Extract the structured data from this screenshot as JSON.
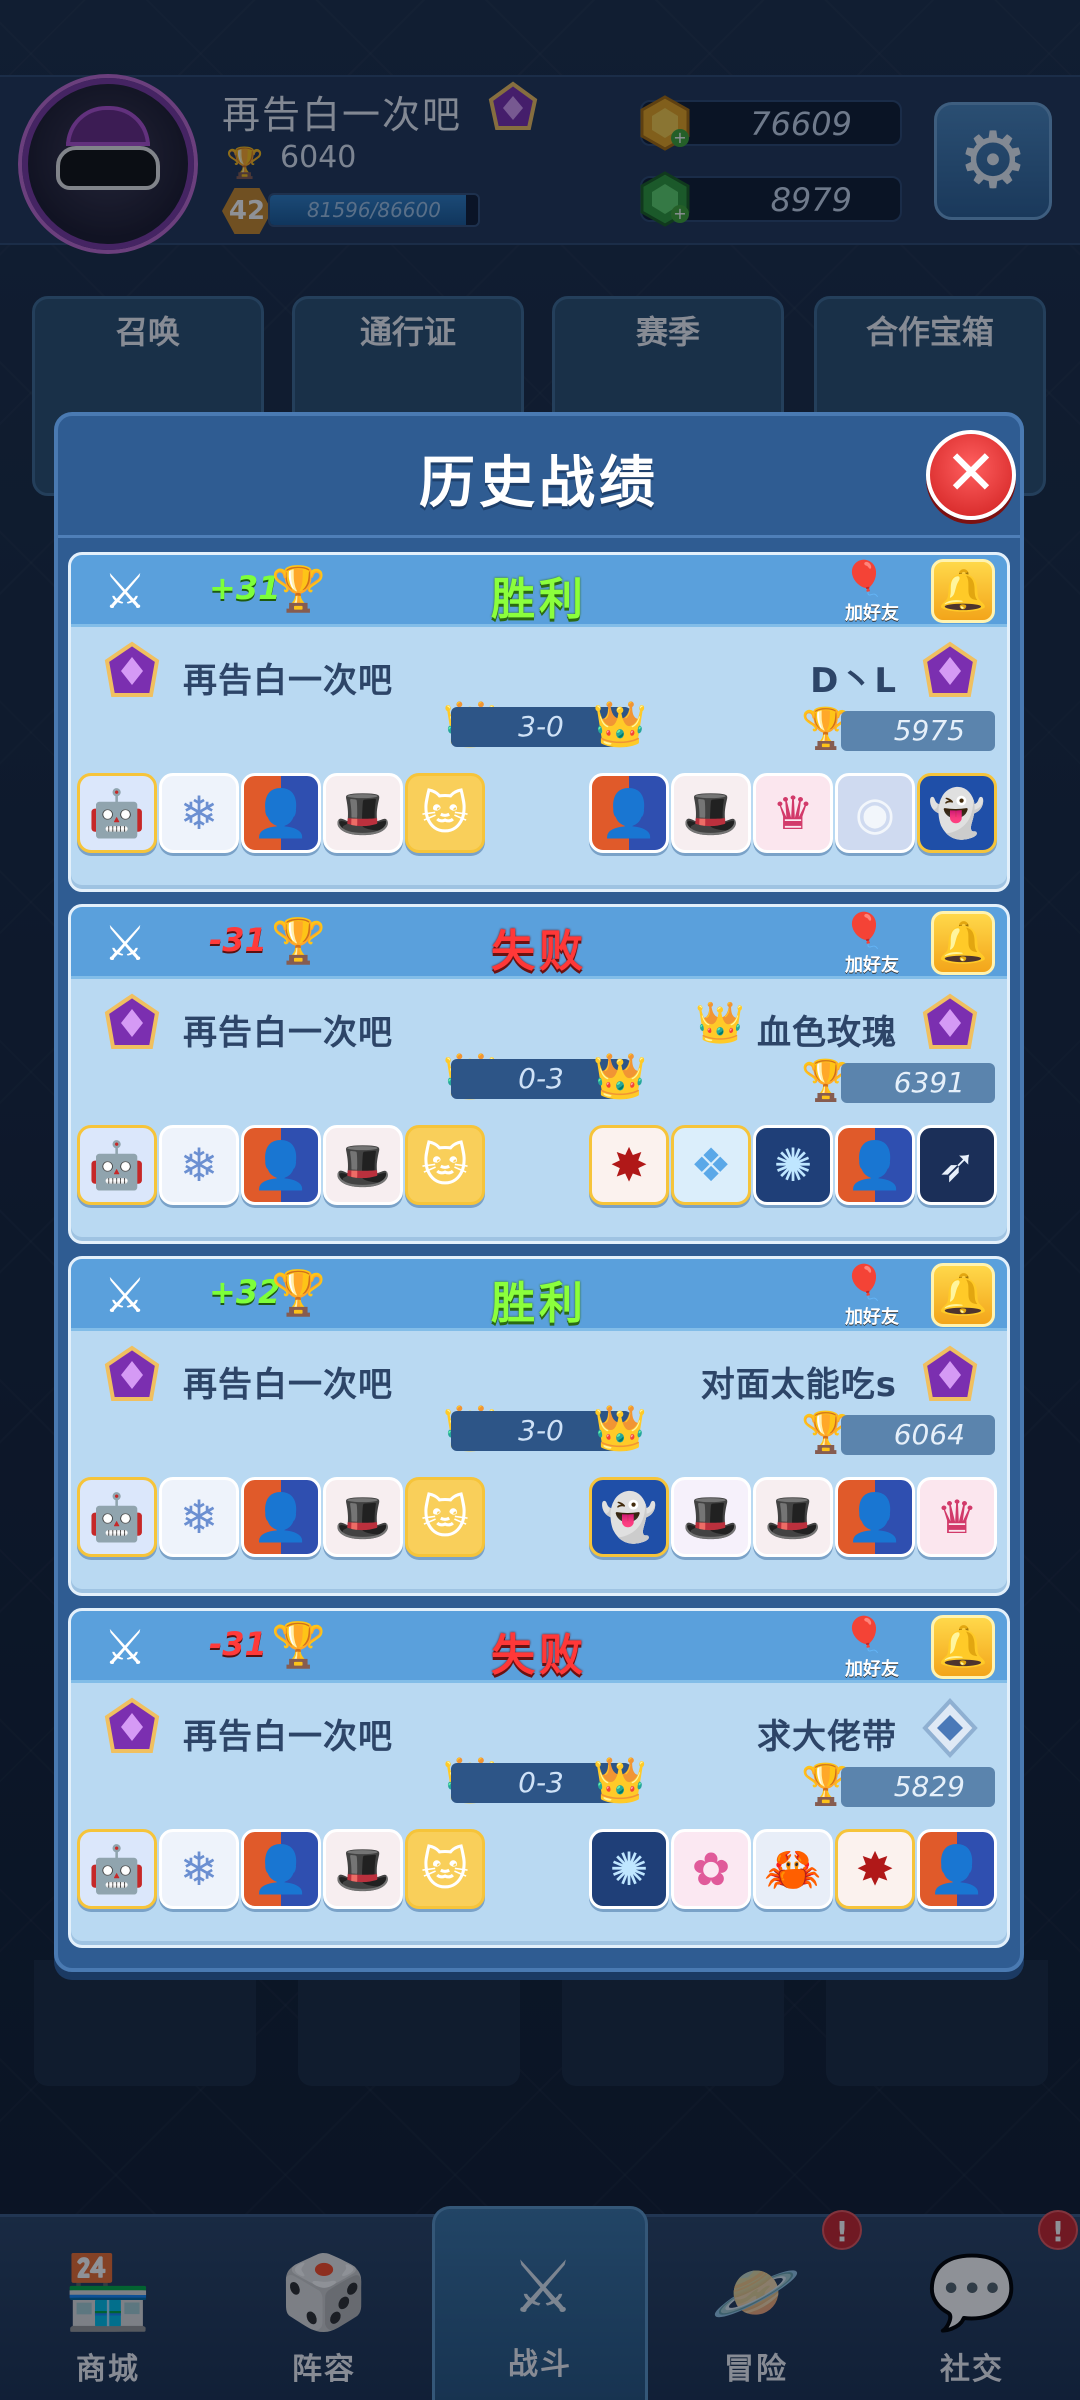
{
  "player": {
    "name": "再告白一次吧",
    "trophies": "6040",
    "level": "42",
    "xp_text": "81596/86600",
    "xp_fraction": 0.942,
    "coins": "76609",
    "gems": "8979"
  },
  "tiles": [
    "召唤",
    "通行证",
    "赛季",
    "合作宝箱"
  ],
  "modal": {
    "title": "历史战绩",
    "close_icon": "close-icon"
  },
  "battles": [
    {
      "delta": "+31",
      "result": "胜利",
      "outcome": "win",
      "add_friend": "加好友",
      "player": "再告白一次吧",
      "score": "3-0",
      "opponent": "D丶L",
      "opponent_trophies": "5975",
      "opponent_crown": false,
      "player_dice": [
        "robot-die-icon",
        "snowflake-die-icon",
        "split-die-icon",
        "hat-die-icon",
        "cat-die-icon"
      ],
      "opponent_dice": [
        "split-die-icon",
        "hat-die-icon",
        "throne-die-icon",
        "moon-die-icon",
        "ghost-die-icon"
      ]
    },
    {
      "delta": "-31",
      "result": "失败",
      "outcome": "lose",
      "add_friend": "加好友",
      "player": "再告白一次吧",
      "score": "0-3",
      "opponent": "血色玫瑰",
      "opponent_trophies": "6391",
      "opponent_crown": true,
      "player_dice": [
        "robot-die-icon",
        "snowflake-die-icon",
        "split-die-icon",
        "hat-die-icon",
        "cat-die-icon"
      ],
      "opponent_dice": [
        "blood-die-icon",
        "wing-die-icon",
        "energy-die-icon",
        "split-die-icon",
        "archer-die-icon"
      ]
    },
    {
      "delta": "+32",
      "result": "胜利",
      "outcome": "win",
      "add_friend": "加好友",
      "player": "再告白一次吧",
      "score": "3-0",
      "opponent": "对面太能吃s",
      "opponent_trophies": "6064",
      "opponent_crown": false,
      "player_dice": [
        "robot-die-icon",
        "snowflake-die-icon",
        "split-die-icon",
        "hat-die-icon",
        "cat-die-icon"
      ],
      "opponent_dice": [
        "ghost-die-icon",
        "magic-hat-die-icon",
        "hat-die-icon",
        "split-die-icon",
        "throne-die-icon"
      ]
    },
    {
      "delta": "-31",
      "result": "失败",
      "outcome": "lose",
      "add_friend": "加好友",
      "player": "再告白一次吧",
      "score": "0-3",
      "opponent": "求大佬带",
      "opponent_trophies": "5829",
      "opponent_crown": false,
      "player_dice": [
        "robot-die-icon",
        "snowflake-die-icon",
        "split-die-icon",
        "hat-die-icon",
        "cat-die-icon"
      ],
      "opponent_dice": [
        "energy-die-icon",
        "blossom-die-icon",
        "crab-die-icon",
        "blood-die-icon",
        "split-die-icon"
      ]
    }
  ],
  "nav": [
    {
      "label": "商城",
      "icon": "shop-icon"
    },
    {
      "label": "阵容",
      "icon": "dice-icon"
    },
    {
      "label": "战斗",
      "icon": "crossed-swords-icon"
    },
    {
      "label": "冒险",
      "icon": "planet-icon"
    },
    {
      "label": "社交",
      "icon": "chat-icon"
    }
  ],
  "alerts": [
    "!",
    "!"
  ]
}
